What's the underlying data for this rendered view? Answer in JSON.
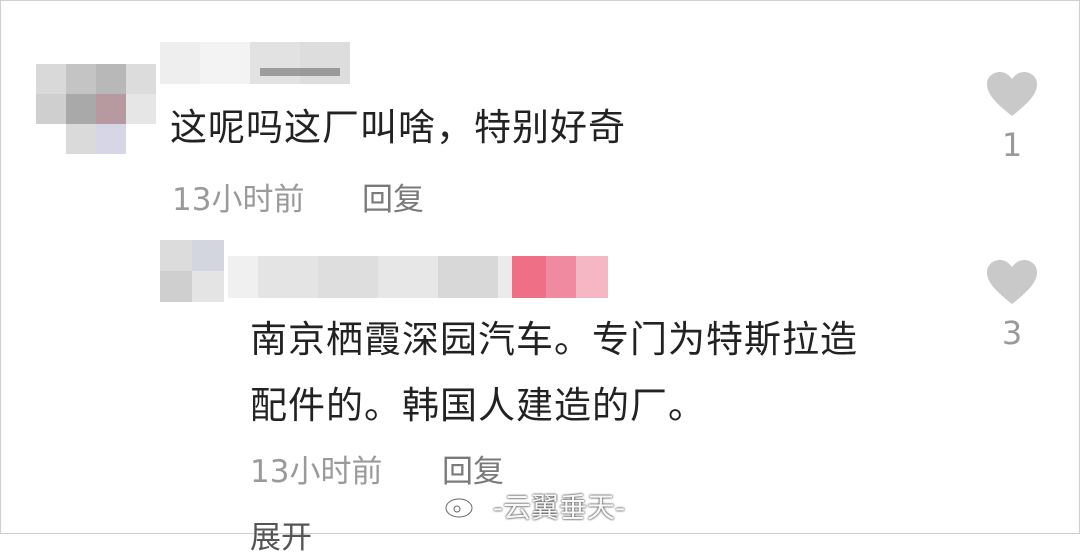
{
  "comments": [
    {
      "text": "这呢吗这厂叫啥，特别好奇",
      "time": "13小时前",
      "reply_label": "回复",
      "likes": "1",
      "author_blurred": true
    },
    {
      "text_line1": "南京栖霞深园汽车。专门为特斯拉造",
      "text_line2": "配件的。韩国人建造的厂。",
      "time": "13小时前",
      "reply_label": "回复",
      "likes": "3",
      "author_blurred": true
    }
  ],
  "expand_label": "展开",
  "watermark": "-云翼垂天-",
  "icons": {
    "like": "heart-icon",
    "watermark_logo": "weibo-logo-icon"
  },
  "colors": {
    "heart": "#c9c9c9",
    "meta": "#9a9a9a",
    "text": "#222222"
  }
}
